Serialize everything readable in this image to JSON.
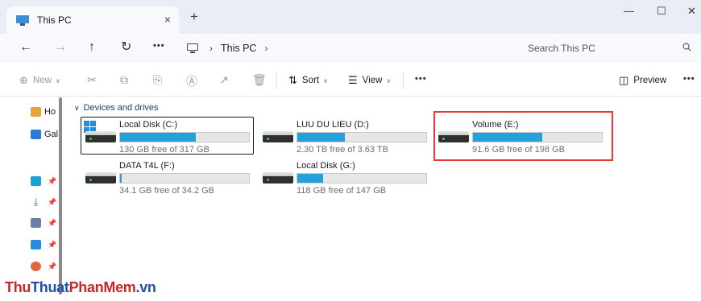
{
  "window": {
    "tab_title": "This PC",
    "tab_close": "×",
    "new_tab": "+",
    "minimize": "—",
    "maximize": "☐",
    "close": "✕"
  },
  "nav": {
    "back": "←",
    "forward": "→",
    "up": "↑",
    "refresh": "↻",
    "more": "•••"
  },
  "address": {
    "breadcrumbs": [
      "This PC"
    ],
    "chevron": "›"
  },
  "search": {
    "placeholder": "Search This PC"
  },
  "toolbar": {
    "new_label": "New",
    "sort_label": "Sort",
    "view_label": "View",
    "preview_label": "Preview",
    "more": "•••",
    "icons": [
      "new-icon",
      "cut-icon",
      "copy-icon",
      "paste-icon",
      "rename-icon",
      "share-icon",
      "delete-icon"
    ]
  },
  "sidebar": {
    "items": [
      {
        "label": "Ho",
        "icon": "home-icon",
        "color": "#e8a33a"
      },
      {
        "label": "Gal",
        "icon": "gallery-icon",
        "color": "#2b7bd6"
      },
      {
        "label": "",
        "icon": "desktop-icon",
        "color": "#1aa3d8",
        "pinned": true
      },
      {
        "label": "",
        "icon": "downloads-icon",
        "color": "#1a9a4a",
        "pinned": true
      },
      {
        "label": "",
        "icon": "documents-icon",
        "color": "#6b7fa8",
        "pinned": true
      },
      {
        "label": "",
        "icon": "pictures-icon",
        "color": "#2b8ad8",
        "pinned": true
      },
      {
        "label": "",
        "icon": "music-icon",
        "color": "#e06a3a",
        "pinned": true
      }
    ]
  },
  "content": {
    "group_title": "Devices and drives",
    "drives": [
      {
        "name": "Local Disk (C:)",
        "free_text": "130 GB free of 317 GB",
        "used_fraction": 0.59,
        "system": true,
        "selected": true
      },
      {
        "name": "LUU DU LIEU (D:)",
        "free_text": "2.30 TB free of 3.63 TB",
        "used_fraction": 0.37
      },
      {
        "name": "Volume (E:)",
        "free_text": "91.6 GB free of 198 GB",
        "used_fraction": 0.54,
        "highlighted": true
      },
      {
        "name": "DATA T4L (F:)",
        "free_text": "34.1 GB free of 34.2 GB",
        "used_fraction": 0.01
      },
      {
        "name": "Local Disk (G:)",
        "free_text": "118 GB free of 147 GB",
        "used_fraction": 0.2
      }
    ],
    "bar_color": "#26a0da",
    "highlight_color": "#e53935"
  },
  "watermark": {
    "part1": "Thu",
    "part2": "Thuat",
    "part3": "PhanMem",
    "part4": ".vn"
  }
}
